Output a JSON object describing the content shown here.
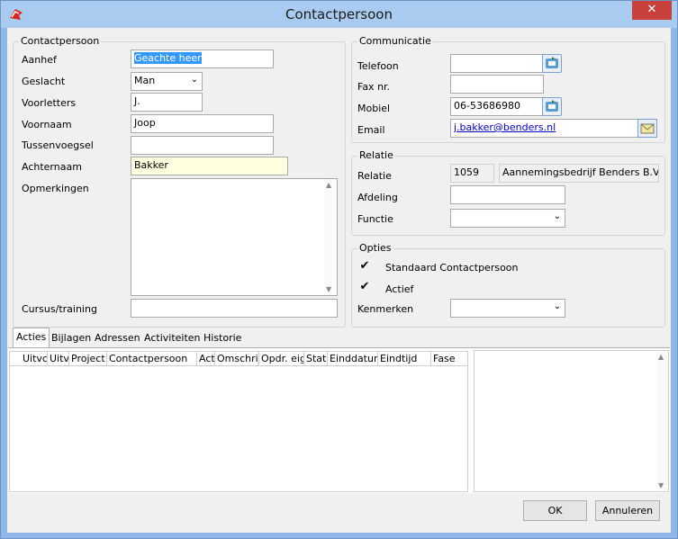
{
  "window": {
    "title": "Contactpersoon",
    "close_label": "✕",
    "accent": "#8fb8e6"
  },
  "contactpersoon": {
    "group_label": "Contactpersoon",
    "aanhef": {
      "label": "Aanhef",
      "value": "Geachte heer"
    },
    "geslacht": {
      "label": "Geslacht",
      "value": "Man"
    },
    "voorletters": {
      "label": "Voorletters",
      "value": "J."
    },
    "voornaam": {
      "label": "Voornaam",
      "value": "Joop"
    },
    "tussenvoegsel": {
      "label": "Tussenvoegsel",
      "value": ""
    },
    "achternaam": {
      "label": "Achternaam",
      "value": "Bakker"
    },
    "opmerkingen": {
      "label": "Opmerkingen",
      "value": ""
    },
    "cursus": {
      "label": "Cursus/training",
      "value": ""
    }
  },
  "communicatie": {
    "group_label": "Communicatie",
    "telefoon": {
      "label": "Telefoon",
      "value": ""
    },
    "fax": {
      "label": "Fax nr.",
      "value": ""
    },
    "mobiel": {
      "label": "Mobiel",
      "value": "06-53686980"
    },
    "email": {
      "label": "Email",
      "value": "j.bakker@benders.nl"
    }
  },
  "relatie": {
    "group_label": "Relatie",
    "relatie": {
      "label": "Relatie",
      "code": "1059",
      "name": "Aannemingsbedrijf Benders B.V."
    },
    "afdeling": {
      "label": "Afdeling",
      "value": ""
    },
    "functie": {
      "label": "Functie",
      "value": ""
    }
  },
  "opties": {
    "group_label": "Opties",
    "standaard": {
      "label": "Standaard Contactpersoon",
      "checked": true
    },
    "actief": {
      "label": "Actief",
      "checked": true
    },
    "kenmerken": {
      "label": "Kenmerken",
      "value": ""
    }
  },
  "tabs": [
    "Acties",
    "Bijlagen",
    "Adressen",
    "Activiteiten Historie"
  ],
  "grid_columns": [
    "Uitvc",
    "Uitvi",
    "Project",
    "Contactpersoon",
    "Act",
    "Omschrijv",
    "Opdr. eig",
    "Stati",
    "Einddatum",
    "Eindtijd",
    "Fase"
  ],
  "buttons": {
    "ok": "OK",
    "cancel": "Annuleren"
  }
}
